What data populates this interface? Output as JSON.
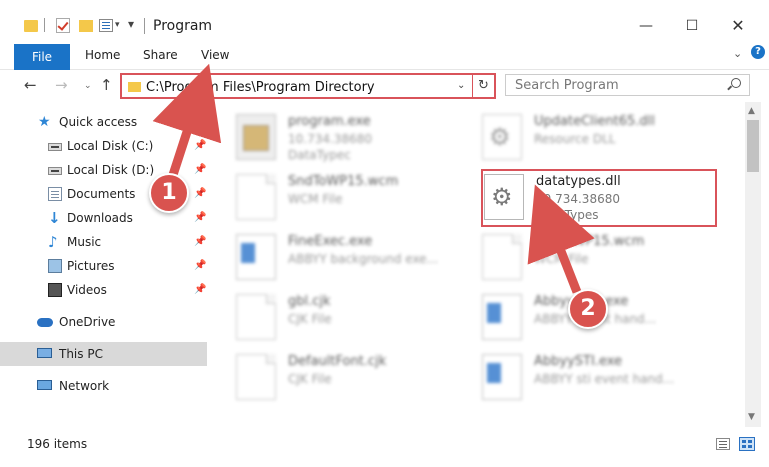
{
  "window": {
    "title": "Program",
    "controls": {
      "minimize": "—",
      "maximize": "☐",
      "close": "✕"
    }
  },
  "ribbon": {
    "tabs": [
      "File",
      "Home",
      "Share",
      "View"
    ]
  },
  "navbar": {
    "address": "C:\\Program Files\\Program Directory",
    "search_placeholder": "Search Program"
  },
  "sidebar": {
    "items": [
      {
        "label": "Quick access",
        "icon": "star-icon",
        "pinned": false
      },
      {
        "label": "Local Disk (C:)",
        "icon": "drive-icon",
        "pinned": true
      },
      {
        "label": "Local Disk (D:)",
        "icon": "drive-icon",
        "pinned": true
      },
      {
        "label": "Documents",
        "icon": "documents-icon",
        "pinned": true
      },
      {
        "label": "Downloads",
        "icon": "download-icon",
        "pinned": true
      },
      {
        "label": "Music",
        "icon": "music-icon",
        "pinned": true
      },
      {
        "label": "Pictures",
        "icon": "pictures-icon",
        "pinned": true
      },
      {
        "label": "Videos",
        "icon": "videos-icon",
        "pinned": true
      },
      {
        "label": "OneDrive",
        "icon": "cloud-icon",
        "pinned": false
      },
      {
        "label": "This PC",
        "icon": "computer-icon",
        "pinned": false,
        "selected": true
      },
      {
        "label": "Network",
        "icon": "network-icon",
        "pinned": false
      }
    ]
  },
  "files": [
    {
      "name": "program.exe",
      "line1": "10.734.38680",
      "line2": "DataTypec",
      "icon": "program-exe-icon",
      "blurred": true
    },
    {
      "name": "UpdateClient65.dll",
      "line1": "Resource DLL",
      "line2": "",
      "icon": "gear-file-icon",
      "blurred": true
    },
    {
      "name": "SndToWP15.wcm",
      "line1": "WCM File",
      "line2": "",
      "icon": "document-icon",
      "blurred": true
    },
    {
      "name": "datatypes.dll",
      "line1": "10.734.38680",
      "line2": "DataTypes",
      "icon": "gear-file-icon",
      "blurred": false
    },
    {
      "name": "FineExec.exe",
      "line1": "ABBYY background exe...",
      "line2": "",
      "icon": "app-icon",
      "blurred": true
    },
    {
      "name": "SndToWP15.wcm",
      "line1": "WCM File",
      "line2": "",
      "icon": "document-icon",
      "blurred": true
    },
    {
      "name": "gbl.cjk",
      "line1": "CJK File",
      "line2": "",
      "icon": "document-icon",
      "blurred": true
    },
    {
      "name": "AbbyyMsg.exe",
      "line1": "ABBYY event hand...",
      "line2": "",
      "icon": "app-icon",
      "blurred": true
    },
    {
      "name": "DefaultFont.cjk",
      "line1": "CJK File",
      "line2": "",
      "icon": "document-icon",
      "blurred": true
    },
    {
      "name": "AbbyySTI.exe",
      "line1": "ABBYY sti event hand...",
      "line2": "",
      "icon": "app-icon",
      "blurred": true
    }
  ],
  "status": {
    "item_count": "196 items"
  },
  "annotations": {
    "step1": "1",
    "step2": "2",
    "accent": "#d9534f"
  }
}
